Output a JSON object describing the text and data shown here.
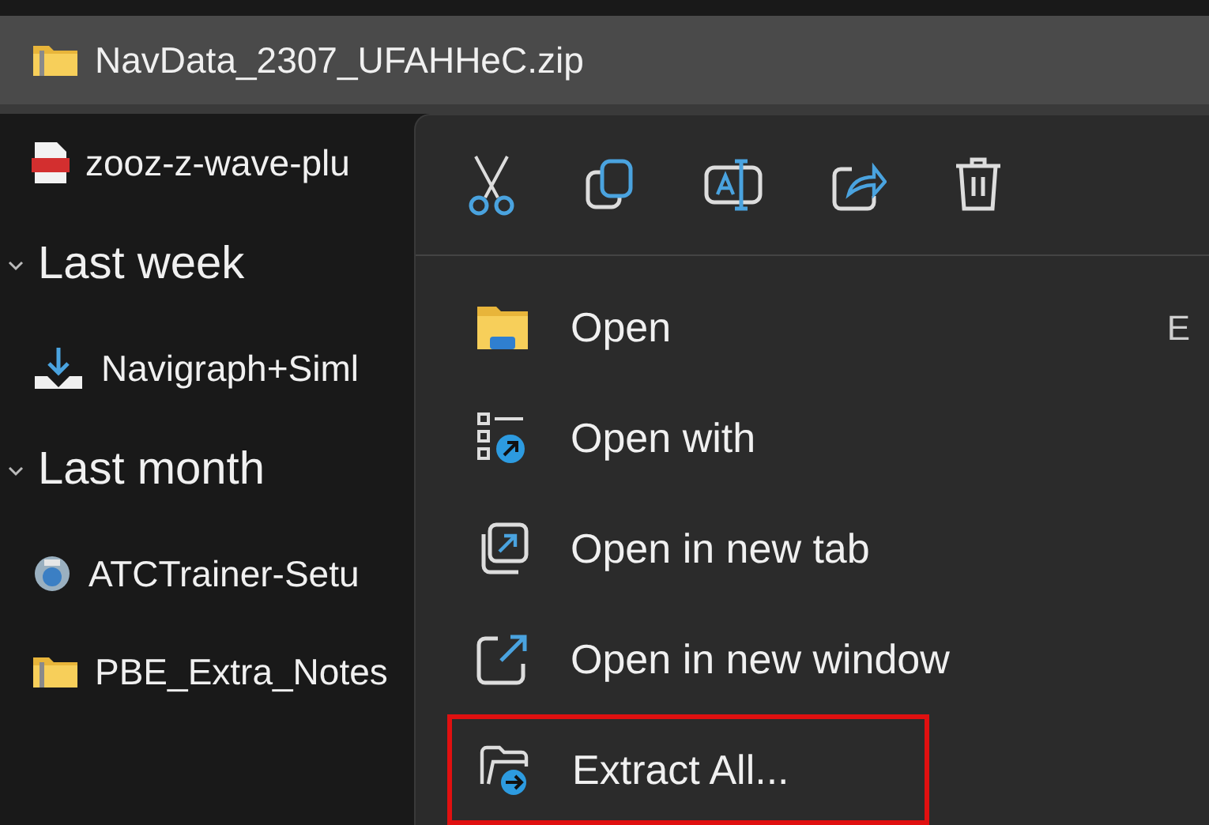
{
  "file_list": [
    {
      "kind": "zip",
      "name": "NavData_2307_UFAHHeC.zip",
      "selected": true
    },
    {
      "kind": "pdf",
      "name": "zooz-z-wave-plu",
      "selected": false
    },
    {
      "kind": "group",
      "name": "Last week",
      "expanded": true
    },
    {
      "kind": "download",
      "name": "Navigraph+Siml",
      "selected": false
    },
    {
      "kind": "group",
      "name": "Last month",
      "expanded": true
    },
    {
      "kind": "installer",
      "name": "ATCTrainer-Setu",
      "selected": false
    },
    {
      "kind": "zip",
      "name": "PBE_Extra_Notes",
      "selected": false
    }
  ],
  "context_menu": {
    "toolbar": [
      {
        "kind": "cut"
      },
      {
        "kind": "copy"
      },
      {
        "kind": "rename"
      },
      {
        "kind": "share"
      },
      {
        "kind": "delete"
      }
    ],
    "items": [
      {
        "kind": "open",
        "label": "Open",
        "shortcut": "E",
        "highlighted": false
      },
      {
        "kind": "open_with",
        "label": "Open with",
        "highlighted": false
      },
      {
        "kind": "new_tab",
        "label": "Open in new tab",
        "highlighted": false
      },
      {
        "kind": "new_window",
        "label": "Open in new window",
        "highlighted": false
      },
      {
        "kind": "extract",
        "label": "Extract All...",
        "highlighted": true
      }
    ]
  }
}
